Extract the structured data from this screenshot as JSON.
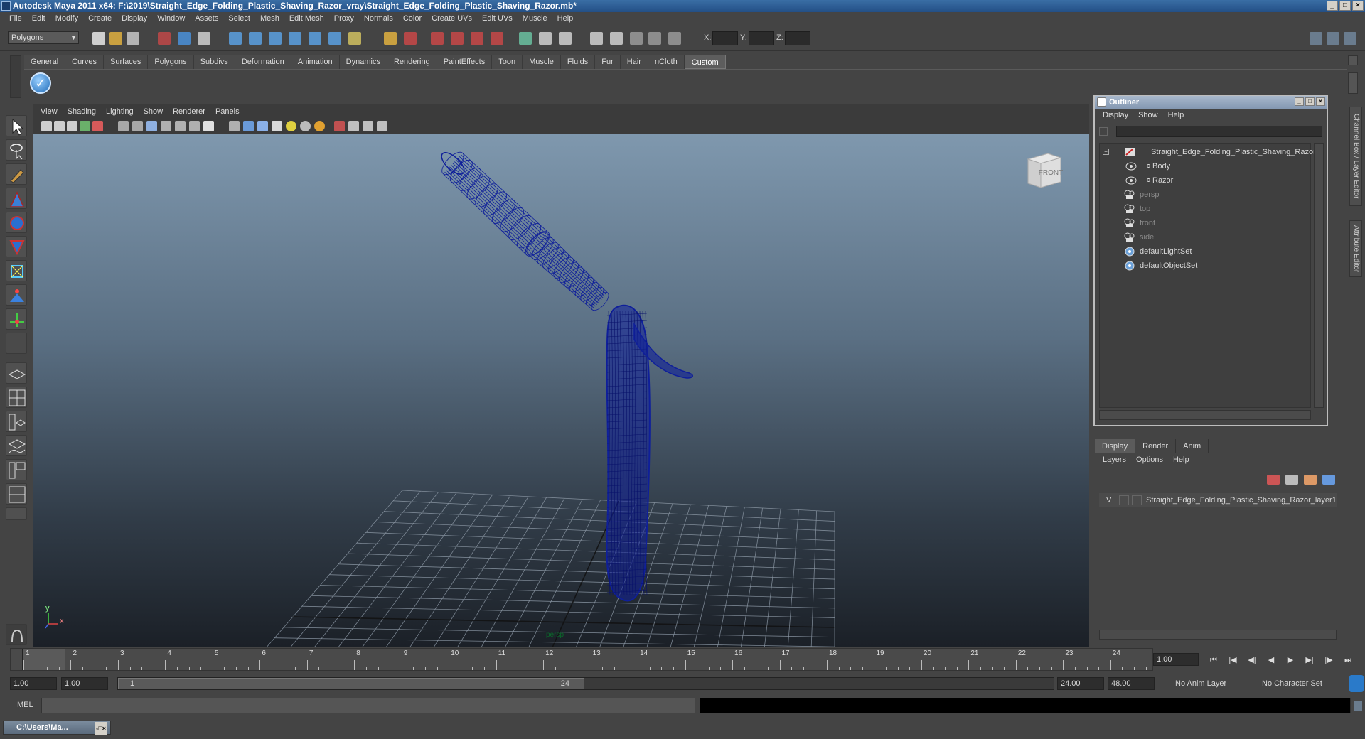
{
  "window": {
    "title": "Autodesk Maya 2011 x64: F:\\2019\\Straight_Edge_Folding_Plastic_Shaving_Razor_vray\\Straight_Edge_Folding_Plastic_Shaving_Razor.mb*"
  },
  "menubar": [
    "File",
    "Edit",
    "Modify",
    "Create",
    "Display",
    "Window",
    "Assets",
    "Select",
    "Mesh",
    "Edit Mesh",
    "Proxy",
    "Normals",
    "Color",
    "Create UVs",
    "Edit UVs",
    "Muscle",
    "Help"
  ],
  "statusline": {
    "mode": "Polygons",
    "x_label": "X:",
    "y_label": "Y:",
    "z_label": "Z:"
  },
  "shelf_tabs": [
    "General",
    "Curves",
    "Surfaces",
    "Polygons",
    "Subdivs",
    "Deformation",
    "Animation",
    "Dynamics",
    "Rendering",
    "PaintEffects",
    "Toon",
    "Muscle",
    "Fluids",
    "Fur",
    "Hair",
    "nCloth",
    "Custom"
  ],
  "shelf_active": "Custom",
  "viewport": {
    "menu": [
      "View",
      "Shading",
      "Lighting",
      "Show",
      "Renderer",
      "Panels"
    ],
    "viewcube_label": "FRONT",
    "camera_label": "persp",
    "axis_y": "y",
    "axis_x": "x",
    "wire_color": "#0f1f9a"
  },
  "outliner": {
    "title": "Outliner",
    "menu": [
      "Display",
      "Show",
      "Help"
    ],
    "items": [
      {
        "label": "Straight_Edge_Folding_Plastic_Shaving_Razor",
        "icon": "group-icon",
        "dim": false
      },
      {
        "label": "Body",
        "icon": "mesh-icon",
        "dim": false
      },
      {
        "label": "Razor",
        "icon": "mesh-icon",
        "dim": false
      },
      {
        "label": "persp",
        "icon": "camera-icon",
        "dim": true
      },
      {
        "label": "top",
        "icon": "camera-icon",
        "dim": true
      },
      {
        "label": "front",
        "icon": "camera-icon",
        "dim": true
      },
      {
        "label": "side",
        "icon": "camera-icon",
        "dim": true
      },
      {
        "label": "defaultLightSet",
        "icon": "set-icon",
        "dim": false
      },
      {
        "label": "defaultObjectSet",
        "icon": "set-icon",
        "dim": false
      }
    ]
  },
  "layers": {
    "tabs": [
      "Display",
      "Render",
      "Anim"
    ],
    "active_tab": "Display",
    "menu": [
      "Layers",
      "Options",
      "Help"
    ],
    "visibility": "V",
    "layer_name": "Straight_Edge_Folding_Plastic_Shaving_Razor_layer1"
  },
  "side_tabs": [
    "Channel Box / Layer Editor",
    "Attribute Editor"
  ],
  "time": {
    "ticks": [
      "1",
      "2",
      "3",
      "4",
      "5",
      "6",
      "7",
      "8",
      "9",
      "10",
      "11",
      "12",
      "13",
      "14",
      "15",
      "16",
      "17",
      "18",
      "19",
      "20",
      "21",
      "22",
      "23",
      "24"
    ],
    "current_frame": "1.00",
    "range_start": "1.00",
    "range_start2": "1.00",
    "range_slider_start": "1",
    "range_slider_end": "24",
    "range_end": "24.00",
    "range_end2": "48.00",
    "anim_layer": "No Anim Layer",
    "character_set": "No Character Set"
  },
  "cmdline": {
    "label": "MEL"
  },
  "taskbar": {
    "item": "C:\\Users\\Ma..."
  }
}
